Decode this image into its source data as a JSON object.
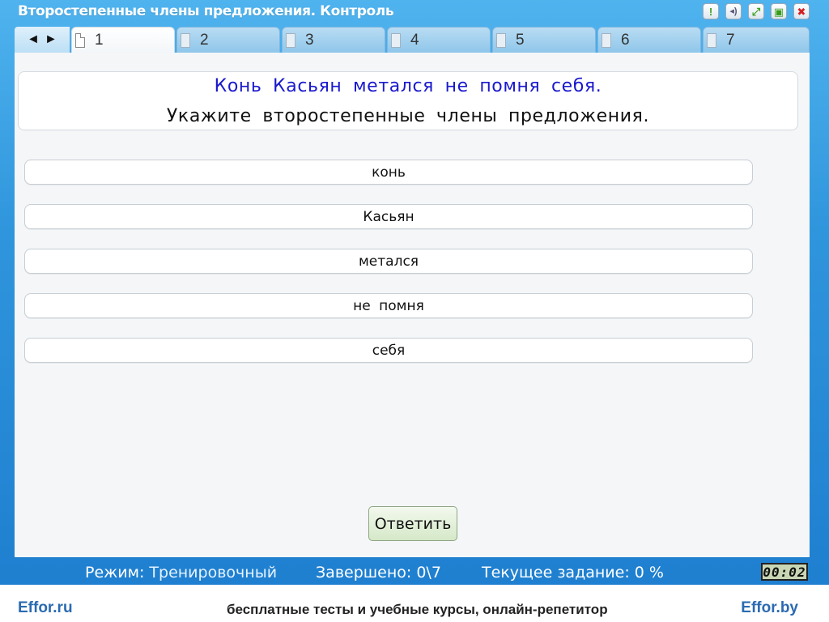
{
  "window": {
    "title": "Второстепенные члены предложения. Контроль",
    "buttons": [
      "hint",
      "sound",
      "fullscreen",
      "save",
      "close"
    ]
  },
  "nav": {
    "prev_icon": "◄",
    "next_icon": "►"
  },
  "tabs": [
    {
      "label": "1",
      "active": true
    },
    {
      "label": "2",
      "active": false
    },
    {
      "label": "3",
      "active": false
    },
    {
      "label": "4",
      "active": false
    },
    {
      "label": "5",
      "active": false
    },
    {
      "label": "6",
      "active": false
    },
    {
      "label": "7",
      "active": false
    }
  ],
  "question": {
    "sentence": "Конь Касьян метался не помня себя.",
    "instruction": "Укажите второстепенные члены предложения."
  },
  "options": [
    {
      "label": "конь"
    },
    {
      "label": "Касьян"
    },
    {
      "label": "метался"
    },
    {
      "label": "не помня"
    },
    {
      "label": "себя"
    }
  ],
  "answer_button": "Ответить",
  "status": {
    "mode_label": "Режим:",
    "mode_value": "Тренировочный",
    "completed": "Завершено: 0\\7",
    "current_task": "Текущее задание: 0 %",
    "timer": "00:02"
  },
  "footer": {
    "left_logo": "Effor.ru",
    "tagline": "бесплатные тесты и учебные курсы, онлайн-репетитор",
    "right_logo": "Effor.by"
  },
  "colors": {
    "accent_blue": "#2f95dc",
    "sentence_text": "#1a1acc",
    "footer_logo": "#2b6ab0"
  }
}
